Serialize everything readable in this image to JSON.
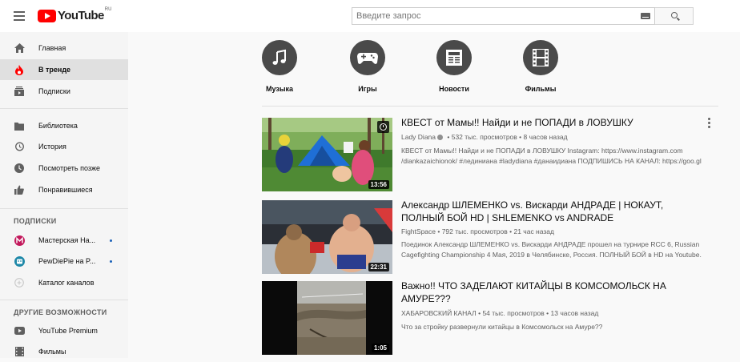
{
  "header": {
    "logo_text": "YouTube",
    "logo_region": "RU",
    "search_placeholder": "Введите запрос"
  },
  "sidebar": {
    "main": [
      {
        "label": "Главная",
        "icon": "home-icon"
      },
      {
        "label": "В тренде",
        "icon": "trending-icon",
        "active": true
      },
      {
        "label": "Подписки",
        "icon": "subscriptions-icon"
      }
    ],
    "library": [
      {
        "label": "Библиотека",
        "icon": "library-icon"
      },
      {
        "label": "История",
        "icon": "history-icon"
      },
      {
        "label": "Посмотреть позже",
        "icon": "watch-later-icon"
      },
      {
        "label": "Понравившиеся",
        "icon": "thumbs-up-icon"
      }
    ],
    "subscriptions_title": "ПОДПИСКИ",
    "subscriptions": [
      {
        "label": "Мастерская На...",
        "icon": "channel-avatar"
      },
      {
        "label": "PewDiePie на P...",
        "icon": "channel-avatar"
      },
      {
        "label": "Каталог каналов",
        "icon": "plus-circle-icon"
      }
    ],
    "more_title": "ДРУГИЕ ВОЗМОЖНОСТИ",
    "more": [
      {
        "label": "YouTube Premium",
        "icon": "youtube-icon"
      },
      {
        "label": "Фильмы",
        "icon": "film-icon"
      }
    ]
  },
  "chips": [
    {
      "label": "Музыка",
      "icon": "music-note-icon"
    },
    {
      "label": "Игры",
      "icon": "gamepad-icon"
    },
    {
      "label": "Новости",
      "icon": "newspaper-icon"
    },
    {
      "label": "Фильмы",
      "icon": "film-icon"
    }
  ],
  "videos": [
    {
      "title": "КВЕСТ от Мамы!! Найди и не ПОПАДИ в ЛОВУШКУ",
      "channel": "Lady Diana",
      "stats": "532 тыс. просмотров • 8 часов назад",
      "description": "КВЕСТ от Мамы!! Найди и не ПОПАДИ в ЛОВУШКУ Instagram: https://www.instagram.com /diankazaichionok/ #лединиана #ladydiana #данаидиана ПОДПИШИСЬ НА КАНАЛ: https://goo.gl",
      "duration": "13:56"
    },
    {
      "title": "Александр ШЛЕМЕНКО vs. Вискарди АНДРАДЕ | НОКАУТ, ПОЛНЫЙ БОЙ HD | SHLEMENKO vs ANDRADE",
      "channel": "FightSpace",
      "stats": "792 тыс. просмотров • 21 час назад",
      "description": "Поединок Александр ШЛЕМЕНКО vs. Вискарди АНДРАДЕ прошел на турнире RCC 6, Russian Cagefighting Championship 4 Мая, 2019 в Челябинске, Россия. ПОЛНЫЙ БОЙ в HD на Youtube.",
      "duration": "22:31"
    },
    {
      "title": "Важно!! ЧТО ЗАДЕЛАЮТ КИТАЙЦЫ В КОМСОМОЛЬСК НА АМУРЕ???",
      "channel": "ХАБАРОВСКИЙ КАНАЛ",
      "stats": "54 тыс. просмотров • 13 часов назад",
      "description": "Что за стройку развернули китайцы в Комсомольск на Амуре??",
      "duration": "1:05"
    }
  ]
}
